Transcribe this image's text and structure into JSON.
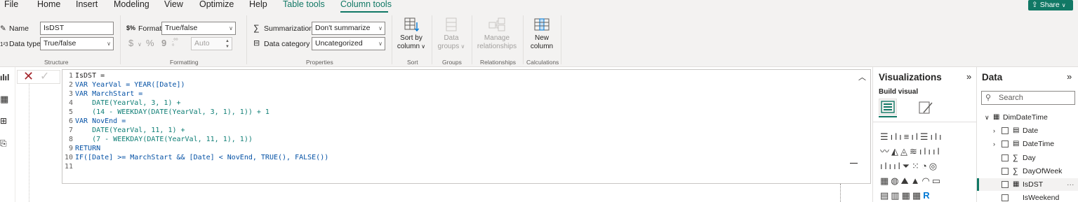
{
  "menu": {
    "items": [
      "File",
      "Home",
      "Insert",
      "Modeling",
      "View",
      "Optimize",
      "Help"
    ],
    "contextual": [
      "Table tools",
      "Column tools"
    ],
    "active": "Column tools",
    "share_label": "Share",
    "accent": "#117865"
  },
  "ribbon": {
    "structure": {
      "name_label": "Name",
      "name_value": "IsDST",
      "datatype_label": "Data type",
      "datatype_value": "True/false",
      "group_label": "Structure"
    },
    "formatting": {
      "format_label": "Format",
      "format_value": "True/false",
      "currency_symbol": "$",
      "percent_symbol": "%",
      "comma_symbol": "9",
      "auto_value": "Auto",
      "group_label": "Formatting"
    },
    "properties": {
      "summarization_label": "Summarization",
      "summarization_value": "Don't summarize",
      "category_label": "Data category",
      "category_value": "Uncategorized",
      "group_label": "Properties"
    },
    "sort": {
      "line1": "Sort by",
      "line2": "column",
      "group_label": "Sort"
    },
    "groups": {
      "line1": "Data",
      "line2": "groups",
      "group_label": "Groups"
    },
    "relationships": {
      "line1": "Manage",
      "line2": "relationships",
      "group_label": "Relationships"
    },
    "calculations": {
      "line1": "New",
      "line2": "column",
      "group_label": "Calculations"
    }
  },
  "formula": {
    "lines": [
      {
        "n": "1",
        "text": "IsDST ="
      },
      {
        "n": "2",
        "text": "VAR YearVal = YEAR([Date])"
      },
      {
        "n": "3",
        "text": "VAR MarchStart ="
      },
      {
        "n": "4",
        "text": "    DATE(YearVal, 3, 1) +"
      },
      {
        "n": "5",
        "text": "    (14 - WEEKDAY(DATE(YearVal, 3, 1), 1)) + 1"
      },
      {
        "n": "6",
        "text": "VAR NovEnd ="
      },
      {
        "n": "7",
        "text": "    DATE(YearVal, 11, 1) +"
      },
      {
        "n": "8",
        "text": "    (7 - WEEKDAY(DATE(YearVal, 11, 1), 1))"
      },
      {
        "n": "9",
        "text": "RETURN"
      },
      {
        "n": "10",
        "text": "IF([Date] >= MarchStart && [Date] < NovEnd, TRUE(), FALSE())"
      },
      {
        "n": "11",
        "text": ""
      }
    ]
  },
  "visualizations": {
    "title": "Visualizations",
    "build_visual": "Build visual"
  },
  "data_pane": {
    "title": "Data",
    "search_placeholder": "Search",
    "table": "DimDateTime",
    "fields": [
      {
        "name": "Date",
        "type": "table-icon",
        "expandable": true
      },
      {
        "name": "DateTime",
        "type": "table-icon",
        "expandable": true
      },
      {
        "name": "Day",
        "type": "sigma-icon",
        "expandable": false
      },
      {
        "name": "DayOfWeek",
        "type": "sigma-icon",
        "expandable": false
      },
      {
        "name": "IsDST",
        "type": "calc-column-icon",
        "expandable": false,
        "selected": true
      },
      {
        "name": "IsWeekend",
        "type": "none",
        "expandable": false
      }
    ]
  }
}
